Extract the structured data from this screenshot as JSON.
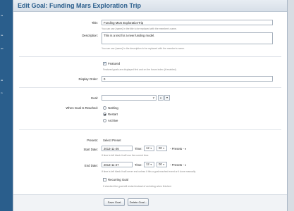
{
  "sidebar": {
    "items": [
      "ns",
      "",
      "ne",
      "ws",
      "",
      "",
      "ok",
      "",
      "m"
    ]
  },
  "header": {
    "prefix": "Edit Goal:",
    "goal_name": "Funding Mars Exploration Trip"
  },
  "form": {
    "title": {
      "label": "Title:",
      "value": "Funding Mars ExplorationTrip",
      "hint": "You can use {name} in the title to be replaced with the member's name."
    },
    "description": {
      "label": "Description:",
      "value": "This is a test for a new funding model.",
      "hint": "You can use {name} in the description to be replaced with the member's name."
    },
    "featured": {
      "label": "Featured",
      "checked": true,
      "hint": "Featured goals are displayed first and on the forum index (if enabled)."
    },
    "display_order": {
      "label": "Display Order:",
      "value": "0"
    },
    "goal": {
      "label": "Goal:",
      "value": "7",
      "step_up": "▴",
      "step_down": "▾"
    },
    "when_reached": {
      "label": "When Goal Is Reached:",
      "options": [
        "Nothing",
        "Restart",
        "Archive"
      ],
      "selected": "Restart"
    },
    "presets": {
      "label": "Presets:",
      "value": "Select Preset"
    },
    "start": {
      "label": "Start Date:",
      "date": "2013-11-26",
      "time_label": "Time:",
      "hour": "12",
      "minute": "00",
      "presets": "- Presets -",
      "hint": "If time is left blank it will use the current time."
    },
    "end": {
      "label": "End Date:",
      "date": "2013-11-27",
      "time_label": "Time:",
      "hour": "12",
      "minute": "00",
      "presets": "- Presets -",
      "hint": "If time is left blank it will never end unless it hits a goal reached event or it done manually."
    },
    "recurring": {
      "label": "Recurring Goal",
      "checked": false,
      "hint": "If checked the goal will restart instead of archiving when finished."
    }
  },
  "buttons": {
    "save": "Save Goal",
    "delete": "Delete Goal..."
  },
  "colors": {
    "accent": "#2a5e8c",
    "title_text": "#3c4f66"
  }
}
